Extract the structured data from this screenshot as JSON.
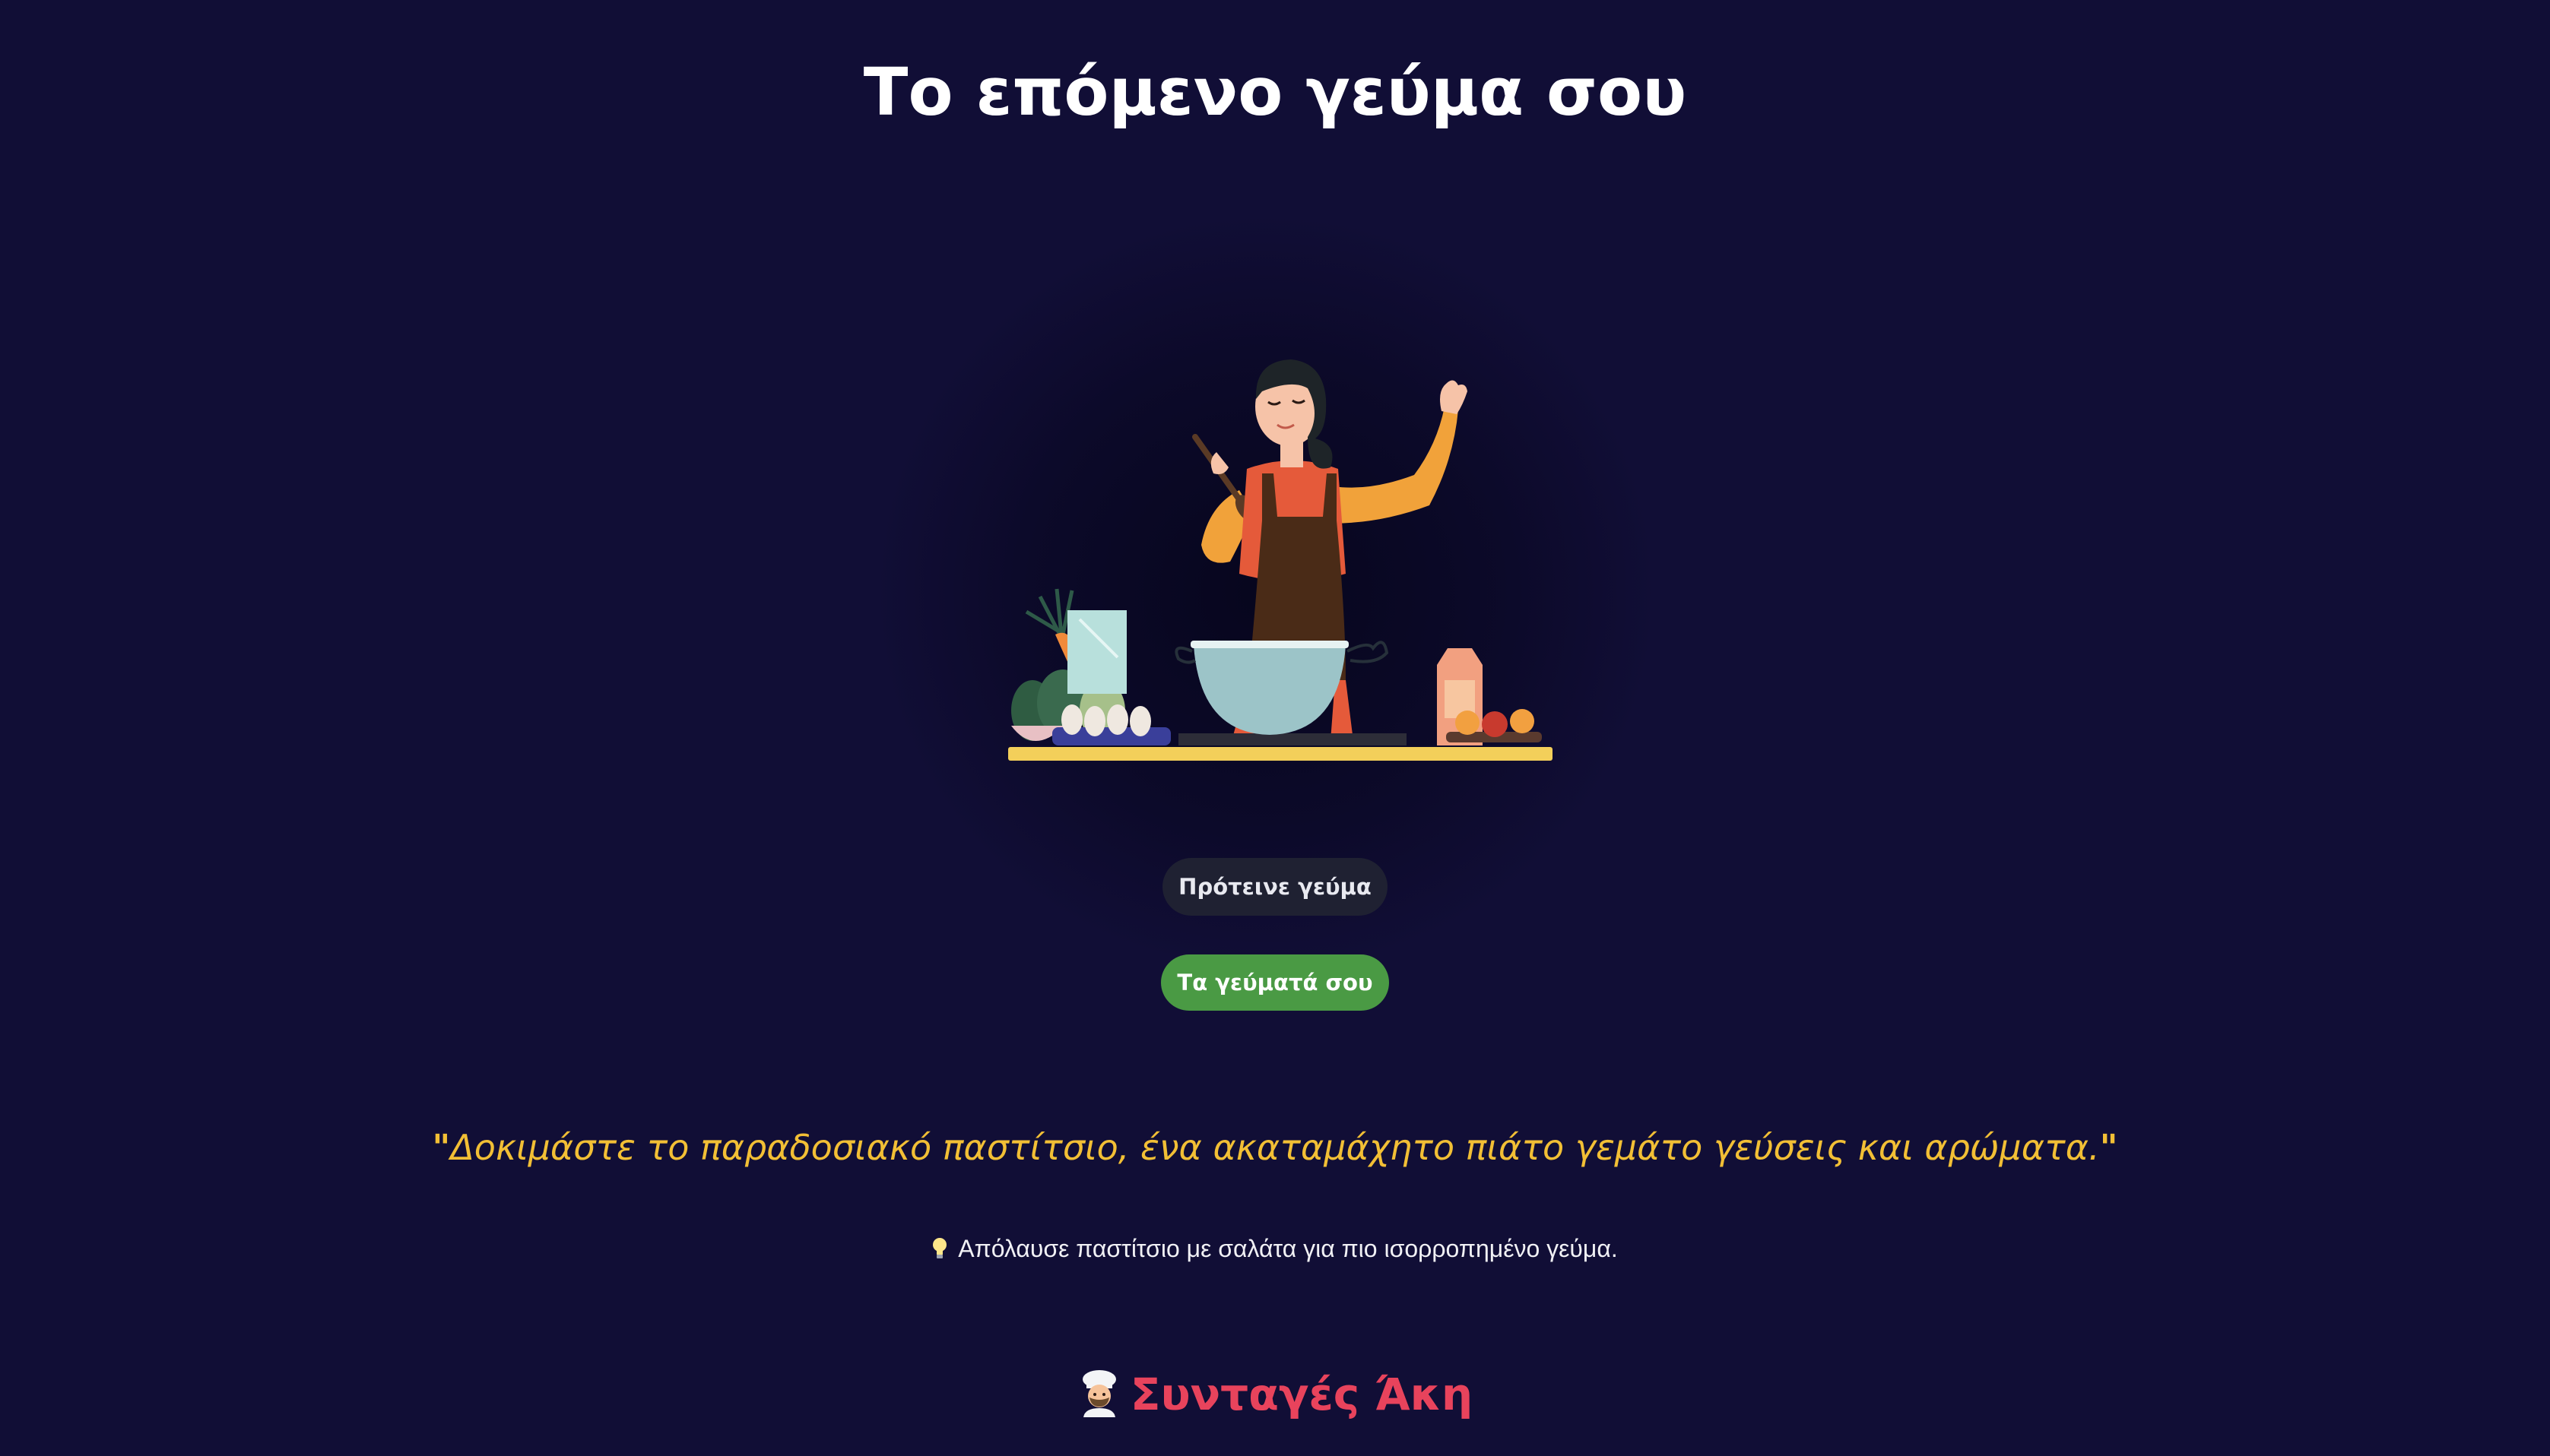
{
  "header": {
    "title": "Το επόμενο γεύμα σου"
  },
  "illustration": {
    "icon": "woman-cooking-illustration"
  },
  "actions": {
    "suggest_label": "Πρότεινε γεύμα",
    "my_meals_label": "Τα γεύματά σου"
  },
  "suggestion": {
    "quote_open": "\"",
    "quote": "Δοκιμάστε το παραδοσιακό παστίτσιο, ένα ακαταμάχητο πιάτο γεμάτο γεύσεις και αρώματα.",
    "quote_close": "\"",
    "tip_icon": "lightbulb-icon",
    "tip": "Απόλαυσε παστίτσιο με σαλάτα για πιο ισορροπημένο γεύμα."
  },
  "footer": {
    "brand_icon": "chef-icon",
    "brand": "Συνταγές Άκη"
  },
  "colors": {
    "background": "#110e36",
    "quote": "#f2bf35",
    "brand": "#e8435c",
    "primary_button": "#4a9a44",
    "secondary_button": "#1f2132"
  }
}
